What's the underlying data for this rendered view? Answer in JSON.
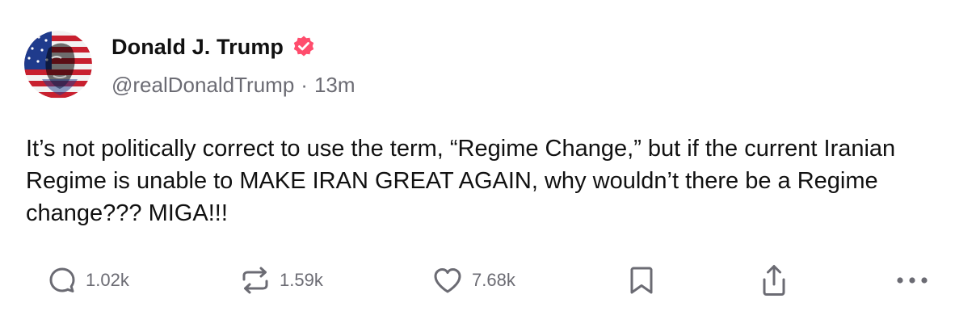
{
  "author": {
    "display_name": "Donald J. Trump",
    "handle": "@realDonaldTrump",
    "separator": "·",
    "time_ago": "13m",
    "verified": true,
    "avatar": "flag-portrait-avatar"
  },
  "post": {
    "text": "It’s not politically correct to use the term, “Regime Change,” but if the current Iranian Regime is unable to MAKE IRAN GREAT AGAIN, why wouldn’t there be a Regime change??? MIGA!!!"
  },
  "actions": {
    "replies": {
      "count": "1.02k",
      "icon": "reply-icon"
    },
    "reposts": {
      "count": "1.59k",
      "icon": "repost-icon"
    },
    "likes": {
      "count": "7.68k",
      "icon": "heart-icon"
    },
    "bookmark": {
      "icon": "bookmark-icon"
    },
    "share": {
      "icon": "share-icon"
    },
    "more": {
      "icon": "more-icon"
    }
  },
  "colors": {
    "text_primary": "#111111",
    "text_secondary": "#6b6b73",
    "verified_badge": "#ff4d6d",
    "icon": "#6b6b73"
  }
}
